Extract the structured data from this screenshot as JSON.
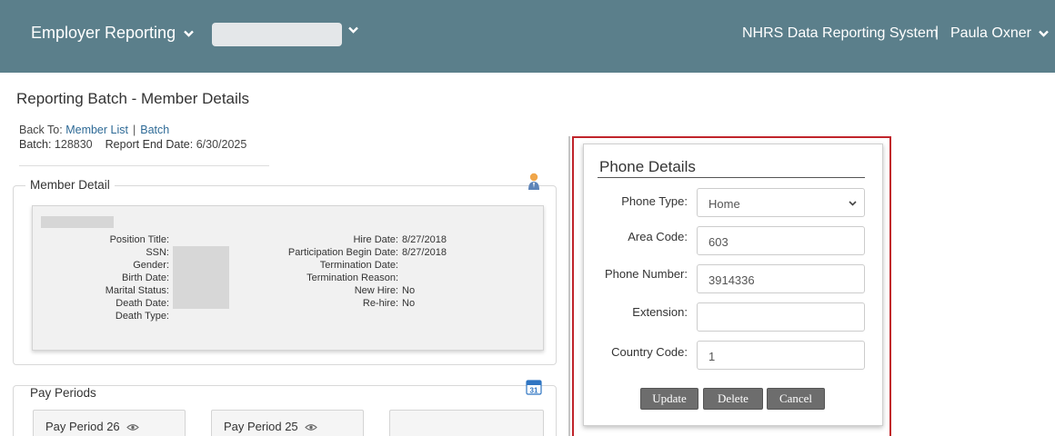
{
  "header": {
    "app_menu_label": "Employer Reporting",
    "system_name": "NHRS Data Reporting System",
    "separator": "|",
    "user_name": "Paula Oxner"
  },
  "page": {
    "title": "Reporting Batch - Member Details",
    "back_to_label": "Back To:",
    "back_links": [
      "Member List",
      "Batch"
    ],
    "back_separator": "|",
    "batch_label": "Batch:",
    "batch_value": "128830",
    "report_end_label": "Report End Date:",
    "report_end_value": "6/30/2025"
  },
  "member_detail": {
    "legend": "Member Detail",
    "left_labels": [
      "Position Title:",
      "SSN:",
      "Gender:",
      "Birth Date:",
      "Marital Status:",
      "Death Date:",
      "Death Type:"
    ],
    "right_labels": [
      "Hire Date:",
      "Participation Begin Date:",
      "Termination Date:",
      "Termination Reason:",
      "New Hire:",
      "Re-hire:"
    ],
    "right_values": [
      "8/27/2018",
      "8/27/2018",
      "",
      "",
      "No",
      "No"
    ]
  },
  "pay_periods": {
    "legend": "Pay Periods",
    "calendar_day": "31",
    "cards": [
      "Pay Period 26",
      "Pay Period 25",
      ""
    ]
  },
  "phone_details": {
    "title": "Phone Details",
    "labels": {
      "phone_type": "Phone Type:",
      "area_code": "Area Code:",
      "phone_number": "Phone Number:",
      "extension": "Extension:",
      "country_code": "Country Code:"
    },
    "values": {
      "phone_type": "Home",
      "area_code": "603",
      "phone_number": "3914336",
      "extension": "",
      "country_code": "1"
    },
    "buttons": {
      "update": "Update",
      "delete": "Delete",
      "cancel": "Cancel"
    }
  },
  "colors": {
    "topbar": "#5b7f8b",
    "link": "#2e6a96",
    "highlight_border": "#c0242b",
    "button": "#6d6d6d"
  },
  "icons": [
    "chevron-down-icon",
    "member-person-icon",
    "calendar-icon",
    "eye-icon"
  ]
}
